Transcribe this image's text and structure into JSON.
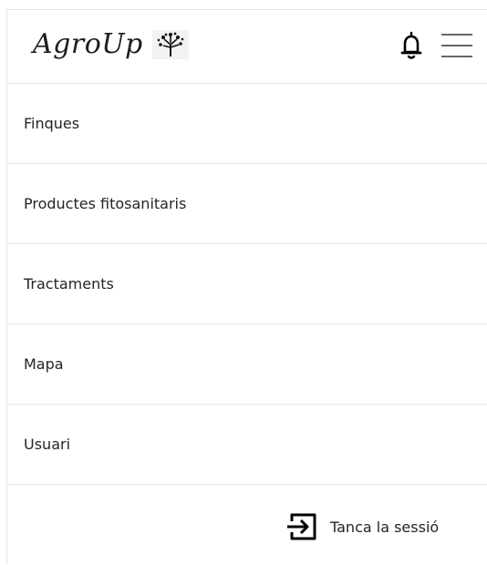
{
  "brand": {
    "name": "AgroUp",
    "logo_icon": "tree-icon"
  },
  "header": {
    "notification_icon": "bell-icon",
    "menu_icon": "hamburger-menu-icon"
  },
  "menu": {
    "items": [
      {
        "label": "Finques"
      },
      {
        "label": "Productes fitosanitaris"
      },
      {
        "label": "Tractaments"
      },
      {
        "label": "Mapa"
      },
      {
        "label": "Usuari"
      }
    ]
  },
  "logout": {
    "label": "Tanca la sessió",
    "icon": "logout-icon"
  }
}
